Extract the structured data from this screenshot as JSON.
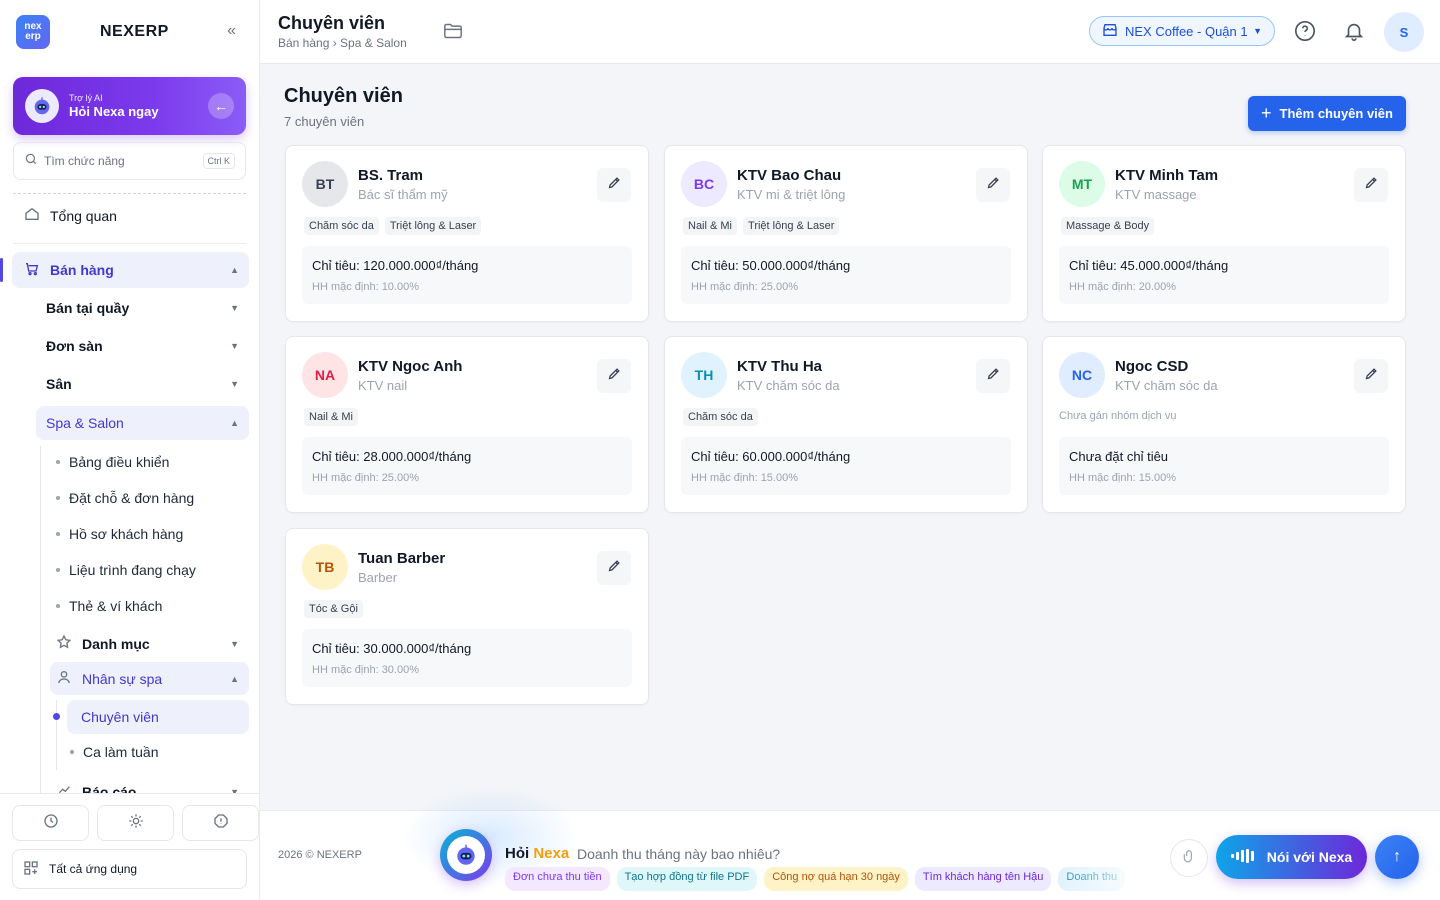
{
  "brand": {
    "logo_text": "nex erp",
    "name": "NEXERP"
  },
  "ai_card": {
    "small": "Trợ lý AI",
    "big": "Hỏi Nexa ngay"
  },
  "search": {
    "placeholder": "Tìm chức năng",
    "shortcut": "Ctrl K"
  },
  "nav": {
    "overview": "Tổng quan",
    "sales": "Bán hàng",
    "pos": "Bán tại quầy",
    "marketplace": "Đơn sàn",
    "court": "Sân",
    "spa": "Spa & Salon",
    "spa_items": [
      "Bảng điều khiển",
      "Đặt chỗ & đơn hàng",
      "Hồ sơ khách hàng",
      "Liệu trình đang chạy",
      "Thẻ & ví khách"
    ],
    "catalog": "Danh mục",
    "staff": "Nhân sự spa",
    "staff_items": [
      "Chuyên viên",
      "Ca làm tuần"
    ],
    "reports": "Báo cáo",
    "all_apps": "Tất cả ứng dụng"
  },
  "header": {
    "title": "Chuyên viên",
    "breadcrumb": "Bán hàng › Spa & Salon",
    "store": "NEX Coffee - Quận 1",
    "avatar": "S"
  },
  "main": {
    "title": "Chuyên viên",
    "count": "7 chuyên viên",
    "add_button": "Thêm chuyên viên"
  },
  "specialists": [
    {
      "initials": "BT",
      "name": "BS. Tram",
      "role": "Bác sĩ thẩm mỹ",
      "tags": [
        "Chăm sóc da",
        "Triệt lông & Laser"
      ],
      "target": "Chỉ tiêu: 120.000.000₫/tháng",
      "commission": "HH mặc định: 10.00%",
      "color": "#374151",
      "bg": "#e5e7eb"
    },
    {
      "initials": "BC",
      "name": "KTV Bao Chau",
      "role": "KTV mi & triệt lông",
      "tags": [
        "Nail & Mi",
        "Triệt lông & Laser"
      ],
      "target": "Chỉ tiêu: 50.000.000₫/tháng",
      "commission": "HH mặc định: 25.00%",
      "color": "#7c3aed",
      "bg": "#ede9fe"
    },
    {
      "initials": "MT",
      "name": "KTV Minh Tam",
      "role": "KTV massage",
      "tags": [
        "Massage & Body"
      ],
      "target": "Chỉ tiêu: 45.000.000₫/tháng",
      "commission": "HH mặc định: 20.00%",
      "color": "#16a34a",
      "bg": "#dcfce7"
    },
    {
      "initials": "NA",
      "name": "KTV Ngoc Anh",
      "role": "KTV nail",
      "tags": [
        "Nail & Mi"
      ],
      "target": "Chỉ tiêu: 28.000.000₫/tháng",
      "commission": "HH mặc định: 25.00%",
      "color": "#e11d48",
      "bg": "#ffe4e6"
    },
    {
      "initials": "TH",
      "name": "KTV Thu Ha",
      "role": "KTV chăm sóc da",
      "tags": [
        "Chăm sóc da"
      ],
      "target": "Chỉ tiêu: 60.000.000₫/tháng",
      "commission": "HH mặc định: 15.00%",
      "color": "#0891b2",
      "bg": "#e0f2fe"
    },
    {
      "initials": "NC",
      "name": "Ngoc CSD",
      "role": "KTV chăm sóc da",
      "tags": [],
      "tag_note": "Chưa gán nhóm dịch vụ",
      "target": "Chưa đặt chỉ tiêu",
      "commission": "HH mặc định: 15.00%",
      "color": "#2563eb",
      "bg": "#e0ecff"
    },
    {
      "initials": "TB",
      "name": "Tuan Barber",
      "role": "Barber",
      "tags": [
        "Tóc & Gội"
      ],
      "target": "Chỉ tiêu: 30.000.000₫/tháng",
      "commission": "HH mặc định: 30.00%",
      "color": "#b45309",
      "bg": "#fef3c7"
    }
  ],
  "footer": {
    "copyright": "2026 © NEXERP",
    "ask_prefix": "Hỏi",
    "ask_brand": "Nexa",
    "prompt": "Doanh thu tháng này bao nhiêu?",
    "chips": [
      {
        "text": "Đơn chưa thu tiền",
        "color": "#7c3aed",
        "bg": "#f3e8ff"
      },
      {
        "text": "Tạo hợp đồng từ file PDF",
        "color": "#0e7490",
        "bg": "#e0f7fa"
      },
      {
        "text": "Công nợ quá hạn 30 ngày",
        "color": "#b45309",
        "bg": "#fef3c7"
      },
      {
        "text": "Tìm khách hàng tên Hậu",
        "color": "#6d28d9",
        "bg": "#ede9fe"
      },
      {
        "text": "Doanh thu",
        "color": "#0891b2",
        "bg": "#e0f2fe"
      }
    ],
    "voice_button": "Nói với Nexa"
  },
  "colors": {
    "primary": "#2563eb",
    "accent": "#7c3aed",
    "active_bg": "#eef0fb"
  }
}
